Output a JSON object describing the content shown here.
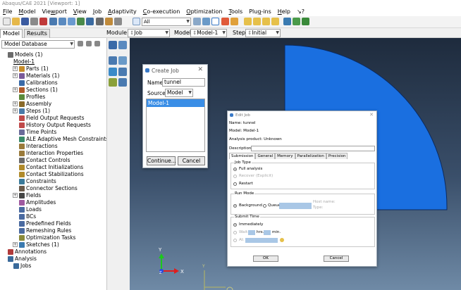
{
  "window": {
    "title": "Abaqus/CAE 2021 [Viewport: 1]"
  },
  "menu": [
    {
      "key": "F",
      "rest": "ile"
    },
    {
      "key": "M",
      "rest": "odel"
    },
    {
      "key": "",
      "pre": "Vie",
      "u": "w",
      "rest": "port"
    },
    {
      "key": "V",
      "rest": "iew"
    },
    {
      "key": "J",
      "rest": "ob"
    },
    {
      "key": "A",
      "rest": "daptivity"
    },
    {
      "key": "C",
      "rest": "o-execution"
    },
    {
      "key": "O",
      "rest": "ptimization"
    },
    {
      "key": "T",
      "rest": "ools"
    },
    {
      "key": "",
      "pre": "Plu",
      "u": "g",
      "rest": "-ins"
    },
    {
      "key": "H",
      "rest": "elp"
    },
    {
      "key": "",
      "rest": "↘?"
    }
  ],
  "toolbar": {
    "selection_filter": "All"
  },
  "tabs": {
    "model": "Model",
    "results": "Results"
  },
  "context": {
    "module_label": "Module:",
    "module_value": "Job",
    "model_label": "Model:",
    "model_value": "Model-1",
    "step_label": "Step:",
    "step_value": "Initial"
  },
  "tree": {
    "selector": "Model Database",
    "rows": [
      {
        "text": "Models (1)",
        "indent": 0,
        "exp": "",
        "icon": "#6b6b6b"
      },
      {
        "text": "Model-1",
        "indent": 1,
        "exp": "",
        "icon": "",
        "underline": true
      },
      {
        "text": "Parts (1)",
        "indent": 2,
        "exp": "+",
        "icon": "#c78d2a"
      },
      {
        "text": "Materials (1)",
        "indent": 2,
        "exp": "+",
        "icon": "#7a5a9a"
      },
      {
        "text": "Calibrations",
        "indent": 2,
        "exp": "",
        "icon": "#3a6aa8"
      },
      {
        "text": "Sections (1)",
        "indent": 2,
        "exp": "+",
        "icon": "#b05a2a"
      },
      {
        "text": "Profiles",
        "indent": 2,
        "exp": "",
        "icon": "#5a8a3a"
      },
      {
        "text": "Assembly",
        "indent": 2,
        "exp": "+",
        "icon": "#8a6a2a"
      },
      {
        "text": "Steps (1)",
        "indent": 2,
        "exp": "+",
        "icon": "#4a7aa8"
      },
      {
        "text": "Field Output Requests",
        "indent": 2,
        "exp": "",
        "icon": "#c04a4a"
      },
      {
        "text": "History Output Requests",
        "indent": 2,
        "exp": "",
        "icon": "#c04a4a"
      },
      {
        "text": "Time Points",
        "indent": 2,
        "exp": "",
        "icon": "#6a6a9a"
      },
      {
        "text": "ALE Adaptive Mesh Constraints",
        "indent": 2,
        "exp": "",
        "icon": "#3a8a6a"
      },
      {
        "text": "Interactions",
        "indent": 2,
        "exp": "",
        "icon": "#9a7a3a"
      },
      {
        "text": "Interaction Properties",
        "indent": 2,
        "exp": "",
        "icon": "#9a7a3a"
      },
      {
        "text": "Contact Controls",
        "indent": 2,
        "exp": "",
        "icon": "#6a6a6a"
      },
      {
        "text": "Contact Initializations",
        "indent": 2,
        "exp": "",
        "icon": "#b08a2a"
      },
      {
        "text": "Contact Stabilizations",
        "indent": 2,
        "exp": "",
        "icon": "#b08a2a"
      },
      {
        "text": "Constraints",
        "indent": 2,
        "exp": "",
        "icon": "#3a7a9a"
      },
      {
        "text": "Connector Sections",
        "indent": 2,
        "exp": "",
        "icon": "#6a5a4a"
      },
      {
        "text": "Fields",
        "indent": 2,
        "exp": "+",
        "icon": "#444444"
      },
      {
        "text": "Amplitudes",
        "indent": 2,
        "exp": "",
        "icon": "#a05aa0"
      },
      {
        "text": "Loads",
        "indent": 2,
        "exp": "",
        "icon": "#4a6aa0"
      },
      {
        "text": "BCs",
        "indent": 2,
        "exp": "",
        "icon": "#4a6aa0"
      },
      {
        "text": "Predefined Fields",
        "indent": 2,
        "exp": "",
        "icon": "#4a6aa0"
      },
      {
        "text": "Remeshing Rules",
        "indent": 2,
        "exp": "",
        "icon": "#4a6aa0"
      },
      {
        "text": "Optimization Tasks",
        "indent": 2,
        "exp": "",
        "icon": "#8a8a3a"
      },
      {
        "text": "Sketches (1)",
        "indent": 2,
        "exp": "+",
        "icon": "#3a7ab0"
      },
      {
        "text": "Annotations",
        "indent": 0,
        "exp": "",
        "icon": "#b03a3a"
      },
      {
        "text": "Analysis",
        "indent": 0,
        "exp": "",
        "icon": "#3a6a9a"
      },
      {
        "text": "Jobs",
        "indent": 1,
        "exp": "",
        "icon": "#3a6a9a"
      }
    ]
  },
  "create_job": {
    "title": "Create Job",
    "close": "✕",
    "name_label": "Name:",
    "name_value": "tunnel",
    "source_label": "Source:",
    "source_value": "Model",
    "list_items": [
      "Model-1"
    ],
    "continue_label": "Continue...",
    "cancel_label": "Cancel"
  },
  "edit_job": {
    "title": "Edit Job",
    "close": "✕",
    "name_line": "Name: tunnel",
    "model_line": "Model: Model-1",
    "product_line": "Analysis product: Unknown",
    "description_label": "Description:",
    "tabs": [
      "Submission",
      "General",
      "Memory",
      "Parallelization",
      "Precision"
    ],
    "job_type_title": "Job Type",
    "job_type_options": [
      {
        "label": "Full analysis",
        "state": "on"
      },
      {
        "label": "Recover (Explicit)",
        "state": "dis"
      },
      {
        "label": "Restart",
        "state": "off"
      }
    ],
    "run_mode_title": "Run Mode",
    "run_mode_background": "Background",
    "run_mode_queue": "Queue:",
    "host_name": "Host name:",
    "type_label": "Type:",
    "submit_time_title": "Submit Time",
    "submit_immediately": "Immediately",
    "submit_wait": "Wait:",
    "hrs": "hrs.",
    "min": "min.",
    "submit_at": "At:",
    "ok_label": "OK",
    "cancel_label": "Cancel"
  },
  "viewport": {
    "triad_y": "Y",
    "triad_x": "X",
    "triad_z": "Z",
    "ref_y": "Y"
  }
}
